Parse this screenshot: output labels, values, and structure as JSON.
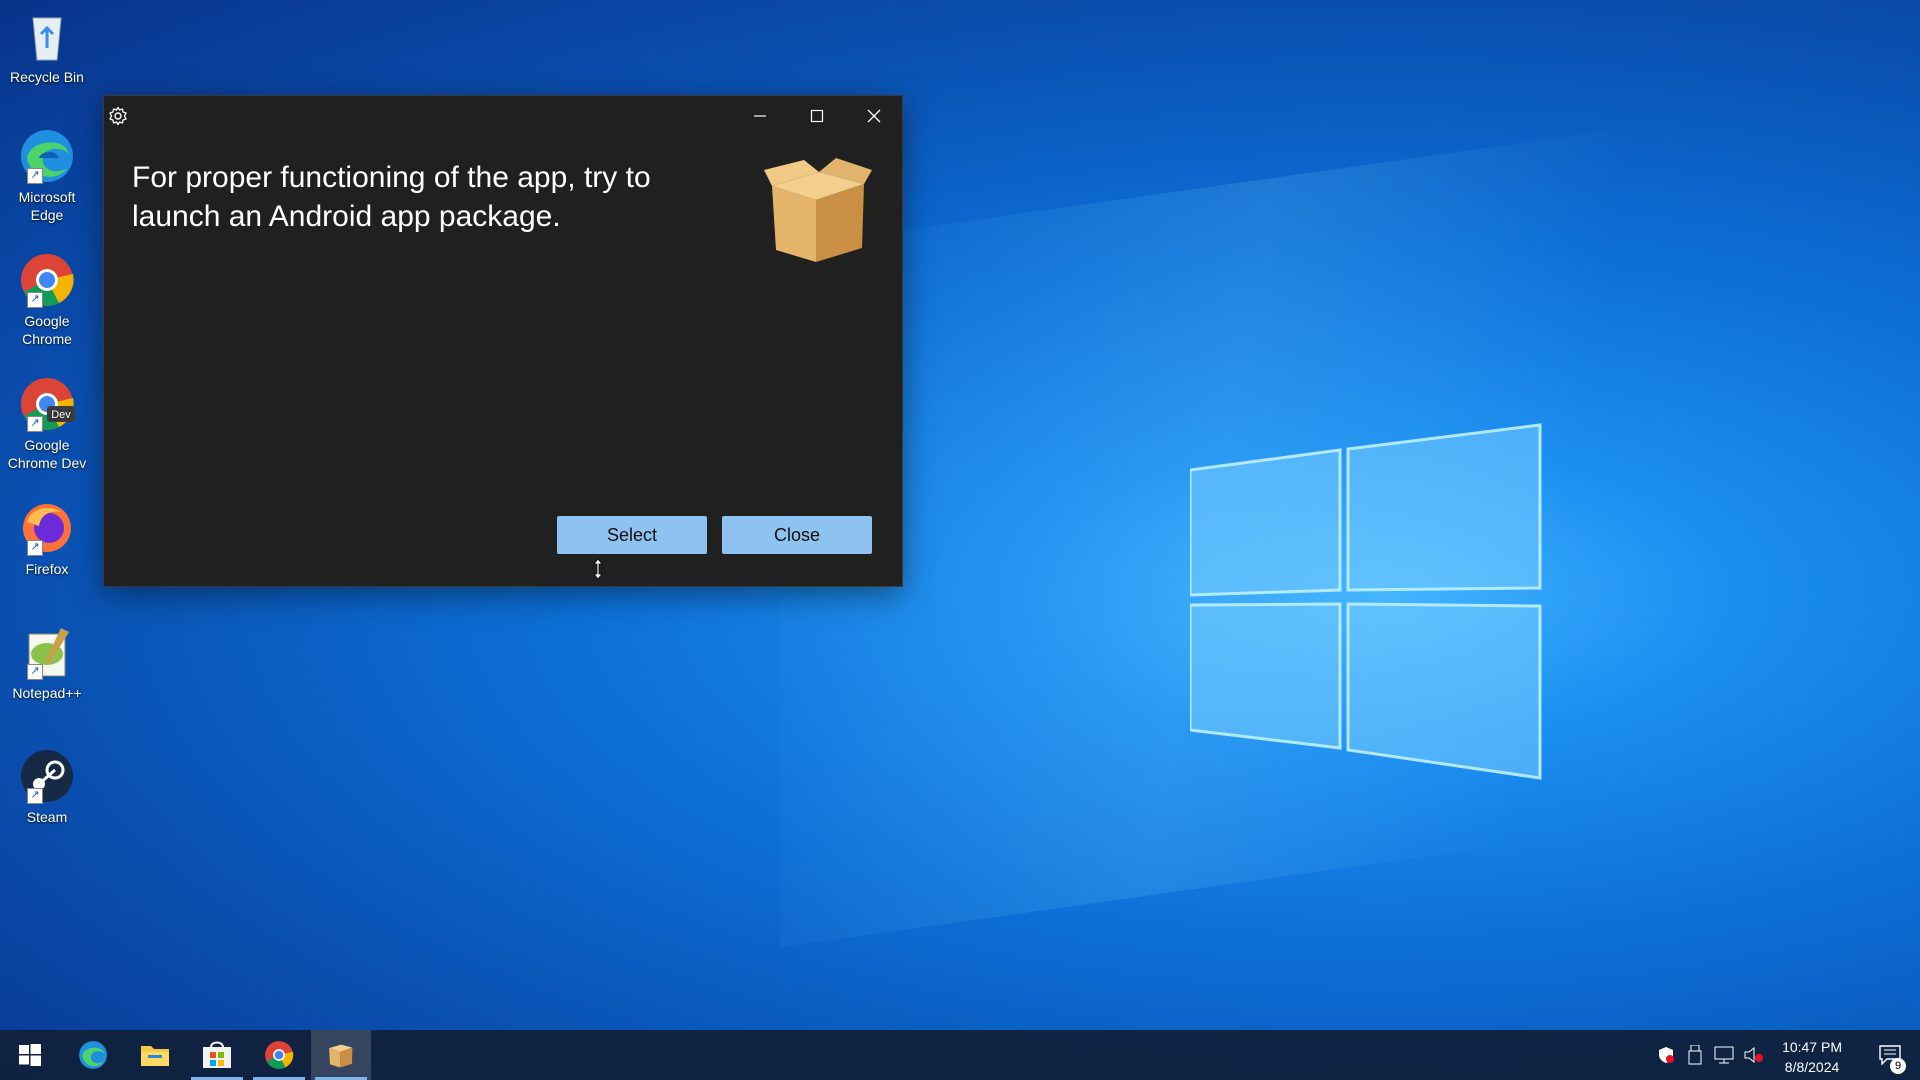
{
  "desktop": {
    "icons": [
      {
        "label": "Recycle Bin",
        "icon": "recycle-bin-icon"
      },
      {
        "label": "Microsoft Edge",
        "icon": "edge-icon"
      },
      {
        "label": "Google Chrome",
        "icon": "chrome-icon"
      },
      {
        "label": "Google Chrome Dev",
        "icon": "chrome-dev-icon",
        "badge": "Dev"
      },
      {
        "label": "Firefox",
        "icon": "firefox-icon"
      },
      {
        "label": "Notepad++",
        "icon": "notepadpp-icon"
      },
      {
        "label": "Steam",
        "icon": "steam-icon"
      }
    ]
  },
  "dialog": {
    "message": "For proper functioning of the app, try to launch an Android app package.",
    "select_label": "Select",
    "close_label": "Close",
    "icons": {
      "settings": "gear-icon",
      "minimize": "minimize-icon",
      "maximize": "maximize-icon",
      "close": "close-icon",
      "illustration": "package-box-icon"
    }
  },
  "taskbar": {
    "apps": [
      "start-icon",
      "edge-icon",
      "file-explorer-icon",
      "microsoft-store-icon",
      "chrome-dev-icon",
      "package-installer-icon"
    ],
    "tray_icons": [
      "security-icon",
      "usb-drive-icon",
      "network-icon",
      "volume-muted-icon"
    ],
    "time": "10:47 PM",
    "date": "8/8/2024",
    "notification_count": "9"
  },
  "colors": {
    "dialog_bg": "#202020",
    "button_bg": "#8ec2f0",
    "taskbar_bg": "#102038"
  }
}
